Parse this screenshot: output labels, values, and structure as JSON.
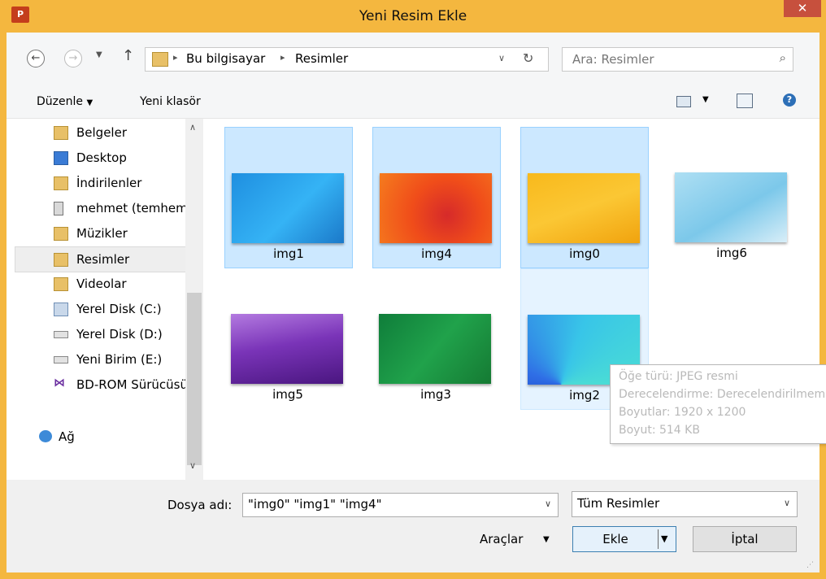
{
  "window": {
    "title": "Yeni Resim Ekle",
    "app_icon": "P",
    "close": "✕"
  },
  "address": {
    "breadcrumb": [
      "Bu bilgisayar",
      "Resimler"
    ],
    "search_placeholder": "Ara: Resimler"
  },
  "commands": {
    "organize": "Düzenle",
    "new_folder": "Yeni klasör"
  },
  "nav": [
    {
      "label": "Belgeler",
      "icon": "documents-folder-icon"
    },
    {
      "label": "Desktop",
      "icon": "desktop-folder-icon"
    },
    {
      "label": "İndirilenler",
      "icon": "downloads-folder-icon"
    },
    {
      "label": "mehmet (temhem",
      "icon": "network-drive-icon"
    },
    {
      "label": "Müzikler",
      "icon": "music-folder-icon"
    },
    {
      "label": "Resimler",
      "icon": "pictures-folder-icon"
    },
    {
      "label": "Videolar",
      "icon": "videos-folder-icon"
    },
    {
      "label": "Yerel Disk (C:)",
      "icon": "system-drive-icon"
    },
    {
      "label": "Yerel Disk (D:)",
      "icon": "drive-icon"
    },
    {
      "label": "Yeni Birim (E:)",
      "icon": "drive-icon"
    },
    {
      "label": "BD-ROM Sürücüsü",
      "icon": "bd-rom-icon"
    },
    {
      "label": "Ağ",
      "icon": "network-icon"
    }
  ],
  "files": [
    {
      "name": "img1",
      "state": "selected"
    },
    {
      "name": "img4",
      "state": "selected"
    },
    {
      "name": "img0",
      "state": "selected"
    },
    {
      "name": "img6",
      "state": "normal"
    },
    {
      "name": "img5",
      "state": "normal"
    },
    {
      "name": "img3",
      "state": "normal"
    },
    {
      "name": "img2",
      "state": "hover"
    }
  ],
  "tooltip": {
    "type": "Öğe türü: JPEG resmi",
    "rating": "Derecelendirme: Derecelendirilmemiş",
    "dimensions": "Boyutlar: 1920 x 1200",
    "size": "Boyut: 514 KB"
  },
  "bottom": {
    "filename_label": "Dosya adı:",
    "filename_value": "\"img0\" \"img1\" \"img4\"",
    "filter": "Tüm Resimler",
    "tools": "Araçlar",
    "insert": "Ekle",
    "cancel": "İptal"
  },
  "colors": {
    "titlebar": "#f4b73f",
    "selection": "#cce8ff",
    "selection_border": "#99d1ff"
  }
}
